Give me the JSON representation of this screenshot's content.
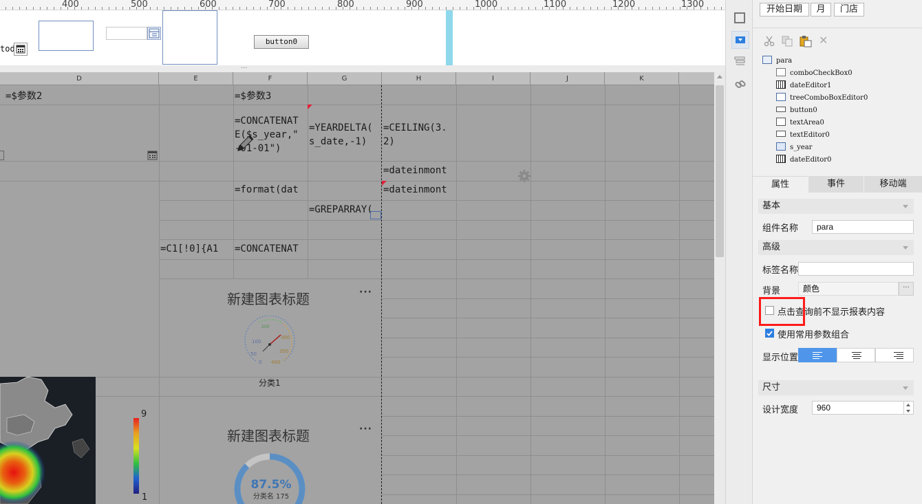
{
  "ruler": {
    "labels": [
      "400",
      "500",
      "600",
      "700",
      "800",
      "900",
      "1000",
      "1100",
      "1200",
      "1300"
    ]
  },
  "param": {
    "truncated_label": "tod",
    "button0_label": "button0"
  },
  "sheet": {
    "columns": [
      "D",
      "E",
      "F",
      "G",
      "H",
      "I",
      "J",
      "K"
    ],
    "cells": {
      "d1": "=$参数2",
      "f1": "=$参数3",
      "f2": "=CONCATENAT\nE($s_year,\"\n-01-01\")",
      "g2": "=YEARDELTA(\ns_date,-1)",
      "h2": "=CEILING(3.\n2)",
      "h3": "=dateinmont",
      "f4": "=format(dat",
      "h4": "=dateinmont",
      "g5": "=GREPARRAY(",
      "e7": "=C1[!0]{A1",
      "f7": "=CONCATENAT"
    },
    "chart1": {
      "title": "新建图表标题",
      "more": "···",
      "gauge_ticks": [
        "100",
        "50",
        "0",
        "500",
        "450",
        "400",
        "350",
        "300",
        "250",
        "200",
        "150"
      ],
      "category": "分类1"
    },
    "chart2": {
      "title": "新建图表标题",
      "more": "···",
      "percent": "87.5%",
      "sublabel": "分类名 175",
      "fraction": 0.875
    },
    "heatmap": {
      "legend_max": "9",
      "legend_min": "1"
    }
  },
  "panel": {
    "top_buttons": [
      "开始日期",
      "月",
      "门店"
    ],
    "tree": {
      "root": "para",
      "children": [
        "comboCheckBox0",
        "dateEditor1",
        "treeComboBoxEditor0",
        "button0",
        "textArea0",
        "textEditor0",
        "s_year",
        "dateEditor0"
      ]
    },
    "tabs": [
      "属性",
      "事件",
      "移动端"
    ],
    "section_basic": "基本",
    "component_name_label": "组件名称",
    "component_name_value": "para",
    "section_advanced": "高级",
    "tag_name_label": "标签名称",
    "tag_name_value": "",
    "background_label": "背景",
    "background_value": "颜色",
    "background_more": "···",
    "check_hide_label": "点击查询前不显示报表内容",
    "check_hide_checked": false,
    "check_common_label": "使用常用参数组合",
    "check_common_checked": true,
    "position_label": "显示位置",
    "section_size": "尺寸",
    "design_width_label": "设计宽度",
    "design_width_value": "960"
  },
  "colors": {
    "sheet_bg": "#a3a3a3",
    "accent_blue": "#4f96ea",
    "highlight_red": "#ff1a1a",
    "gauge_ring": "#5b8fc4",
    "progress_track": "#c4c4c4"
  }
}
